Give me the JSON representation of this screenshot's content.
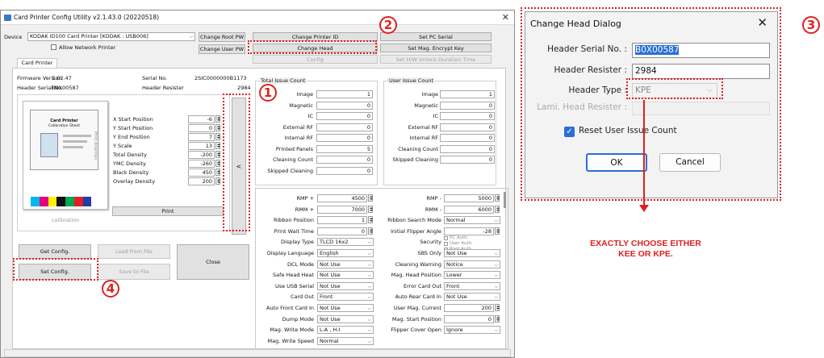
{
  "main_window": {
    "title": "Card Printer Config Utility v2.1.43.0 (20220518)",
    "device_label": "Device",
    "device_value": "KODAK ID100 Card Printer  [KODAK : USB006]",
    "allow_network": "Allow Network Printer",
    "tab": "Card Printer",
    "buttons": {
      "change_root_pw": "Change Root PW",
      "change_user_pw": "Change User PW",
      "change_printer_id": "Change Printer ID",
      "set_pc_serial": "Set PC Serial",
      "change_head": "Change Head",
      "set_mag_encrypt": "Set Mag. Encrypt Key",
      "config": "Config",
      "set_hw_unlock": "Set H/W Unlock Duration Time",
      "print": "Print",
      "collapse": "<",
      "get_config": "Get Config.",
      "load_from_file": "Load from File",
      "close": "Close",
      "set_config": "Set Config.",
      "save_to_file": "Save to File"
    },
    "info": {
      "firmware_label": "Firmware Version",
      "firmware_value": "1.02.47",
      "serial_label": "Serial No.",
      "serial_value": "2SIC0000000B1173",
      "header_serial_label": "Header Serial No.",
      "header_serial_value": "B0X00587",
      "header_resister_label": "Header Resister",
      "header_resister_value": "2984"
    },
    "calibration": {
      "card_title": "Card Printer",
      "card_sub": "Calibration Sheet",
      "caption": "calibration",
      "vertical_text": "Print direction",
      "colors": [
        "#00b7eb",
        "#e4007c",
        "#fff200",
        "#111111",
        "#00a650",
        "#e31e24",
        "#1e3ea8",
        "#ffffff"
      ]
    },
    "positions": [
      {
        "label": "X Start Position",
        "value": "-6"
      },
      {
        "label": "Y Start Position",
        "value": "0"
      },
      {
        "label": "Y End Position",
        "value": "7"
      },
      {
        "label": "Y Scale",
        "value": "13"
      },
      {
        "label": "Total Density",
        "value": "-200"
      },
      {
        "label": "YMC Density",
        "value": "-260"
      },
      {
        "label": "Black Density",
        "value": "450"
      },
      {
        "label": "Overlay Density",
        "value": "200"
      }
    ],
    "total_issue": {
      "title": "Total Issue Count",
      "rows": [
        {
          "label": "Image",
          "value": "1"
        },
        {
          "label": "Magnetic",
          "value": "0"
        },
        {
          "label": "IC",
          "value": "0"
        },
        {
          "label": "External RF",
          "value": "0"
        },
        {
          "label": "Internal RF",
          "value": "0"
        },
        {
          "label": "Printed Panels",
          "value": "5"
        },
        {
          "label": "Cleaning Count",
          "value": "0"
        },
        {
          "label": "Skipped Cleaning",
          "value": "0"
        }
      ]
    },
    "user_issue": {
      "title": "User Issue Count",
      "rows": [
        {
          "label": "Image",
          "value": "1"
        },
        {
          "label": "Magnetic",
          "value": "0"
        },
        {
          "label": "IC",
          "value": "0"
        },
        {
          "label": "External RF",
          "value": "0"
        },
        {
          "label": "Internal RF",
          "value": "0"
        },
        {
          "label": "Cleaning Count",
          "value": "0"
        },
        {
          "label": "Skipped Cleaning",
          "value": "0"
        }
      ]
    },
    "settings_left": [
      {
        "label": "RMP +",
        "value": "4500",
        "kind": "spin"
      },
      {
        "label": "RMM +",
        "value": "7000",
        "kind": "spin"
      },
      {
        "label": "Ribbon Position",
        "value": "1",
        "kind": "spin"
      },
      {
        "label": "Print Wait Time",
        "value": "0",
        "kind": "spin"
      },
      {
        "label": "Display Type",
        "value": "TLCD 16x2",
        "kind": "combo"
      },
      {
        "label": "Display Language",
        "value": "English",
        "kind": "combo"
      },
      {
        "label": "DCL Mode",
        "value": "Not Use",
        "kind": "combo"
      },
      {
        "label": "Safe Head Heat",
        "value": "Not Use",
        "kind": "combo"
      },
      {
        "label": "Use USB Serial",
        "value": "Not Use",
        "kind": "combo"
      },
      {
        "label": "Card Out",
        "value": "Front",
        "kind": "combo"
      },
      {
        "label": "Auto Front Card In",
        "value": "Not Use",
        "kind": "combo"
      },
      {
        "label": "Dump Mode",
        "value": "Not Use",
        "kind": "combo"
      },
      {
        "label": "Mag. Write Mode",
        "value": "L:A , H:I",
        "kind": "combo"
      },
      {
        "label": "Mag. Write Speed",
        "value": "Normal",
        "kind": "combo"
      }
    ],
    "settings_right": [
      {
        "label": "RMP -",
        "value": "5000",
        "kind": "spin"
      },
      {
        "label": "RMM -",
        "value": "6000",
        "kind": "spin"
      },
      {
        "label": "Ribbon Search Mode",
        "value": "Normal",
        "kind": "combo"
      },
      {
        "label": "Initial Flipper Angle",
        "value": "-28",
        "kind": "spin"
      },
      {
        "label": "Security",
        "value": "",
        "kind": "checks"
      },
      {
        "label": "SBS Only",
        "value": "Not Use",
        "kind": "combo"
      },
      {
        "label": "Cleaning Warning",
        "value": "Notice",
        "kind": "combo"
      },
      {
        "label": "Mag. Head Position",
        "value": "Lower",
        "kind": "combo"
      },
      {
        "label": "Error Card Out",
        "value": "Front",
        "kind": "combo"
      },
      {
        "label": "Auto Rear Card In",
        "value": "Not Use",
        "kind": "combo"
      },
      {
        "label": "User Mag. Current",
        "value": "200",
        "kind": "spin"
      },
      {
        "label": "Mag. Start Position",
        "value": "0",
        "kind": "spin"
      },
      {
        "label": "Flipper Cover Open",
        "value": "Ignore",
        "kind": "combo"
      }
    ],
    "security_options": [
      "PC Auth.",
      "User Auth.",
      "Root Auth."
    ]
  },
  "dialog": {
    "title": "Change Head Dialog",
    "serial_label": "Header Serial No. :",
    "serial_value": "B0X00587",
    "resister_label": "Header Resister :",
    "resister_value": "2984",
    "type_label": "Header Type :",
    "type_value": "KPE",
    "lami_label": "Lami. Head Resister :",
    "reset_label": "Reset User Issue Count",
    "ok": "OK",
    "cancel": "Cancel"
  },
  "annotations": {
    "steps": [
      "1",
      "2",
      "3",
      "4"
    ],
    "note_line1": "EXACTLY CHOOSE EITHER",
    "note_line2": "KEE OR KPE.",
    "color": "#e02020"
  }
}
